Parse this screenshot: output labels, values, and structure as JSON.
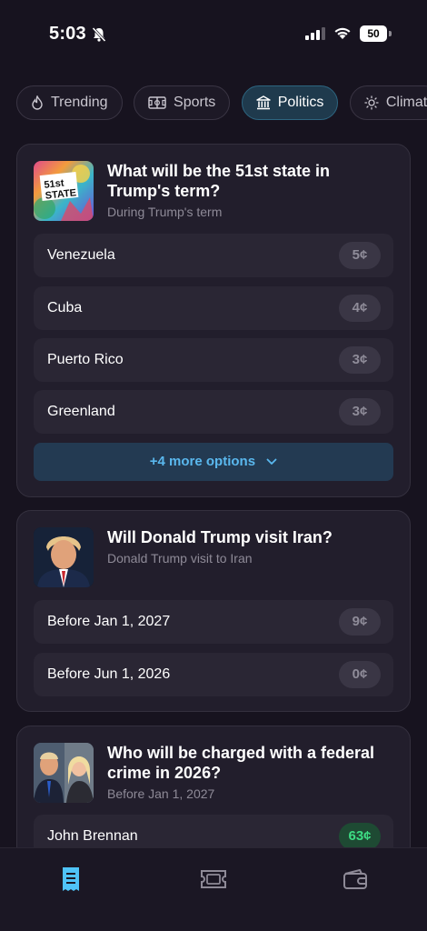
{
  "status_bar": {
    "time": "5:03",
    "battery": "50"
  },
  "tabs": [
    {
      "label": "Trending",
      "icon": "flame-icon"
    },
    {
      "label": "Sports",
      "icon": "sports-field-icon"
    },
    {
      "label": "Politics",
      "icon": "capitol-icon",
      "active": true
    },
    {
      "label": "Climat",
      "icon": "sun-icon"
    }
  ],
  "markets": [
    {
      "title": "What will be the 51st state in Trump's term?",
      "subtitle": "During Trump's term",
      "thumb_text": "51st STATE",
      "options": [
        {
          "label": "Venezuela",
          "price": "5¢"
        },
        {
          "label": "Cuba",
          "price": "4¢"
        },
        {
          "label": "Puerto Rico",
          "price": "3¢"
        },
        {
          "label": "Greenland",
          "price": "3¢"
        }
      ],
      "more_label": "+4 more options"
    },
    {
      "title": "Will Donald Trump visit Iran?",
      "subtitle": "Donald Trump visit to Iran",
      "options": [
        {
          "label": "Before Jan 1, 2027",
          "price": "9¢"
        },
        {
          "label": "Before Jun 1, 2026",
          "price": "0¢"
        }
      ]
    },
    {
      "title": "Who will be charged with a federal crime in 2026?",
      "subtitle": "Before Jan 1, 2027",
      "options": [
        {
          "label": "John Brennan",
          "price": "63¢",
          "highlight": true
        }
      ]
    }
  ],
  "bottom_nav": [
    {
      "name": "markets",
      "icon": "receipt-icon",
      "active": true
    },
    {
      "name": "tickets",
      "icon": "ticket-icon"
    },
    {
      "name": "wallet",
      "icon": "wallet-icon"
    }
  ],
  "colors": {
    "accent": "#4fc3f7",
    "positive": "#3ddc84",
    "background": "#17131f",
    "card": "#221e2c"
  }
}
